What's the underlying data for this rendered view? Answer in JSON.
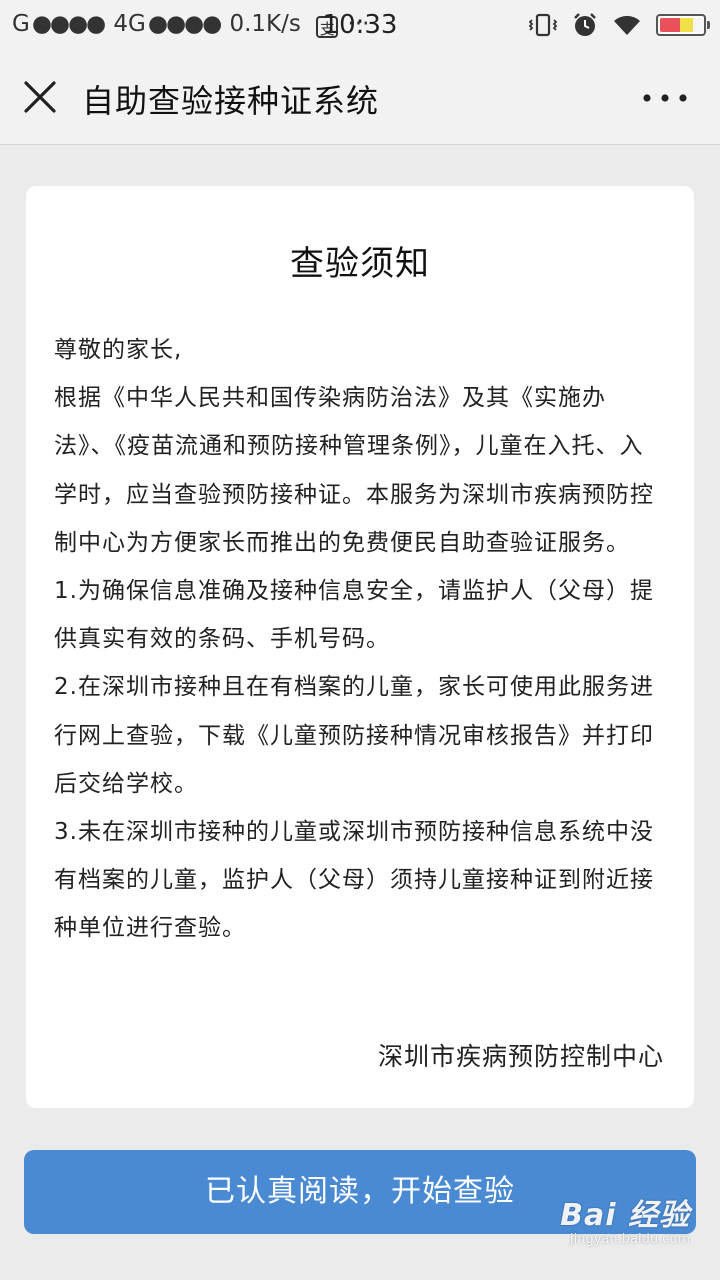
{
  "status_bar": {
    "carrier": "G",
    "signal_dots_1": "●●●●",
    "network": "4G",
    "signal_dots_2": "●●●●",
    "speed": "0.1K/s",
    "pay_glyph": "支",
    "more_dots": "···",
    "time": "10:33",
    "icons": [
      "vibrate-icon",
      "alarm-icon",
      "wifi-icon",
      "battery-icon"
    ]
  },
  "nav": {
    "title": "自助查验接种证系统",
    "close_icon": "close-icon",
    "more_icon": "more-icon"
  },
  "notice": {
    "title": "查验须知",
    "paragraphs": [
      "尊敬的家长,",
      "根据《中华人民共和国传染病防治法》及其《实施办法》、《疫苗流通和预防接种管理条例》，儿童在入托、入学时，应当查验预防接种证。本服务为深圳市疾病预防控制中心为方便家长而推出的免费便民自助查验证服务。",
      "1.为确保信息准确及接种信息安全，请监护人（父母）提供真实有效的条码、手机号码。",
      "2.在深圳市接种且在有档案的儿童，家长可使用此服务进行网上查验，下载《儿童预防接种情况审核报告》并打印后交给学校。",
      "3.未在深圳市接种的儿童或深圳市预防接种信息系统中没有档案的儿童，监护人（父母）须持儿童接种证到附近接种单位进行查验。"
    ],
    "signature": "深圳市疾病预防控制中心"
  },
  "action": {
    "start_label": "已认真阅读，开始查验"
  },
  "watermark": {
    "logo": "Bai 经验",
    "url": "jingyan.baidu.com"
  },
  "colors": {
    "button_bg": "#4a8ad3",
    "page_bg": "#ebebeb",
    "card_bg": "#ffffff"
  }
}
